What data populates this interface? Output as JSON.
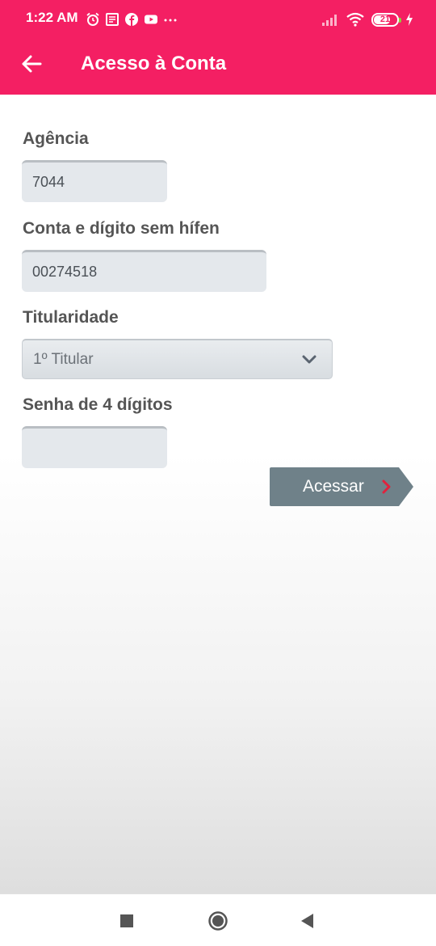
{
  "status_bar": {
    "time": "1:22 AM",
    "left_icons": [
      "alarm-icon",
      "news-icon",
      "facebook-icon",
      "youtube-icon",
      "more-dots-icon"
    ],
    "right_icons": [
      "signal-icon",
      "wifi-icon",
      "battery-icon",
      "charging-icon"
    ],
    "battery_level": "21"
  },
  "toolbar": {
    "title": "Acesso à Conta",
    "back_icon": "arrow-left-icon"
  },
  "form": {
    "agencia": {
      "label": "Agência",
      "value": "7044"
    },
    "conta": {
      "label": "Conta e dígito sem hífen",
      "value": "00274518"
    },
    "titularidade": {
      "label": "Titularidade",
      "selected": "1º Titular"
    },
    "senha": {
      "label": "Senha de 4 dígitos",
      "value": ""
    },
    "submit_label": "Acessar"
  },
  "colors": {
    "brand": "#f41f63",
    "button": "#6f8189",
    "chevron_accent": "#e0223d",
    "label": "#555555"
  },
  "nav": {
    "icons": [
      "recents-square-icon",
      "home-circle-icon",
      "back-triangle-icon"
    ]
  }
}
